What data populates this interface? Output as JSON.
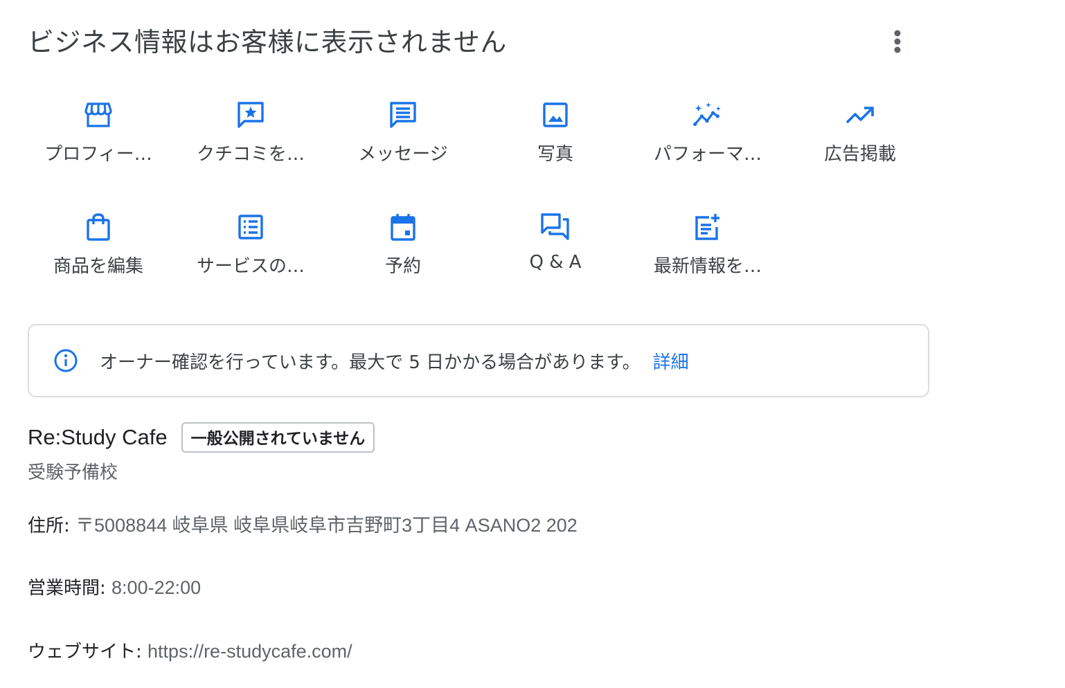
{
  "header": {
    "title": "ビジネス情報はお客様に表示されません",
    "more_icon": "more-vert-icon"
  },
  "colors": {
    "accent": "#1a73e8",
    "text_primary": "#202124",
    "text_secondary": "#5f6368",
    "border": "#dadce0"
  },
  "actions": [
    {
      "label": "プロフィー…",
      "icon": "storefront-icon"
    },
    {
      "label": "クチコミを…",
      "icon": "review-star-icon"
    },
    {
      "label": "メッセージ",
      "icon": "message-icon"
    },
    {
      "label": "写真",
      "icon": "photo-icon"
    },
    {
      "label": "パフォーマ…",
      "icon": "performance-sparkle-icon"
    },
    {
      "label": "広告掲載",
      "icon": "trending-up-icon"
    },
    {
      "label": "商品を編集",
      "icon": "shopping-bag-icon"
    },
    {
      "label": "サービスの…",
      "icon": "service-list-icon"
    },
    {
      "label": "予約",
      "icon": "calendar-icon"
    },
    {
      "label": "Q & A",
      "icon": "qa-forum-icon"
    },
    {
      "label": "最新情報を…",
      "icon": "post-add-icon"
    }
  ],
  "notice": {
    "icon": "info-icon",
    "text": "オーナー確認を行っています。最大で 5 日かかる場合があります。",
    "link_label": "詳細"
  },
  "business": {
    "name": "Re:Study Cafe",
    "badge": "一般公開されていません",
    "category": "受験予備校",
    "address_label": "住所:",
    "address_value": "〒5008844 岐阜県 岐阜県岐阜市吉野町3丁目4 ASANO2 202",
    "hours_label": "営業時間:",
    "hours_value": "8:00-22:00",
    "website_label": "ウェブサイト:",
    "website_value": "https://re-studycafe.com/"
  }
}
